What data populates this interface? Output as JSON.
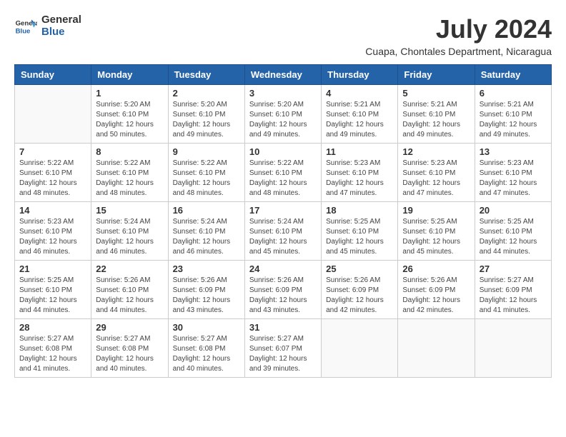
{
  "logo": {
    "line1": "General",
    "line2": "Blue"
  },
  "title": "July 2024",
  "location": "Cuapa, Chontales Department, Nicaragua",
  "days_header": [
    "Sunday",
    "Monday",
    "Tuesday",
    "Wednesday",
    "Thursday",
    "Friday",
    "Saturday"
  ],
  "weeks": [
    [
      {
        "day": "",
        "sunrise": "",
        "sunset": "",
        "daylight": ""
      },
      {
        "day": "1",
        "sunrise": "Sunrise: 5:20 AM",
        "sunset": "Sunset: 6:10 PM",
        "daylight": "Daylight: 12 hours and 50 minutes."
      },
      {
        "day": "2",
        "sunrise": "Sunrise: 5:20 AM",
        "sunset": "Sunset: 6:10 PM",
        "daylight": "Daylight: 12 hours and 49 minutes."
      },
      {
        "day": "3",
        "sunrise": "Sunrise: 5:20 AM",
        "sunset": "Sunset: 6:10 PM",
        "daylight": "Daylight: 12 hours and 49 minutes."
      },
      {
        "day": "4",
        "sunrise": "Sunrise: 5:21 AM",
        "sunset": "Sunset: 6:10 PM",
        "daylight": "Daylight: 12 hours and 49 minutes."
      },
      {
        "day": "5",
        "sunrise": "Sunrise: 5:21 AM",
        "sunset": "Sunset: 6:10 PM",
        "daylight": "Daylight: 12 hours and 49 minutes."
      },
      {
        "day": "6",
        "sunrise": "Sunrise: 5:21 AM",
        "sunset": "Sunset: 6:10 PM",
        "daylight": "Daylight: 12 hours and 49 minutes."
      }
    ],
    [
      {
        "day": "7",
        "sunrise": "Sunrise: 5:22 AM",
        "sunset": "Sunset: 6:10 PM",
        "daylight": "Daylight: 12 hours and 48 minutes."
      },
      {
        "day": "8",
        "sunrise": "Sunrise: 5:22 AM",
        "sunset": "Sunset: 6:10 PM",
        "daylight": "Daylight: 12 hours and 48 minutes."
      },
      {
        "day": "9",
        "sunrise": "Sunrise: 5:22 AM",
        "sunset": "Sunset: 6:10 PM",
        "daylight": "Daylight: 12 hours and 48 minutes."
      },
      {
        "day": "10",
        "sunrise": "Sunrise: 5:22 AM",
        "sunset": "Sunset: 6:10 PM",
        "daylight": "Daylight: 12 hours and 48 minutes."
      },
      {
        "day": "11",
        "sunrise": "Sunrise: 5:23 AM",
        "sunset": "Sunset: 6:10 PM",
        "daylight": "Daylight: 12 hours and 47 minutes."
      },
      {
        "day": "12",
        "sunrise": "Sunrise: 5:23 AM",
        "sunset": "Sunset: 6:10 PM",
        "daylight": "Daylight: 12 hours and 47 minutes."
      },
      {
        "day": "13",
        "sunrise": "Sunrise: 5:23 AM",
        "sunset": "Sunset: 6:10 PM",
        "daylight": "Daylight: 12 hours and 47 minutes."
      }
    ],
    [
      {
        "day": "14",
        "sunrise": "Sunrise: 5:23 AM",
        "sunset": "Sunset: 6:10 PM",
        "daylight": "Daylight: 12 hours and 46 minutes."
      },
      {
        "day": "15",
        "sunrise": "Sunrise: 5:24 AM",
        "sunset": "Sunset: 6:10 PM",
        "daylight": "Daylight: 12 hours and 46 minutes."
      },
      {
        "day": "16",
        "sunrise": "Sunrise: 5:24 AM",
        "sunset": "Sunset: 6:10 PM",
        "daylight": "Daylight: 12 hours and 46 minutes."
      },
      {
        "day": "17",
        "sunrise": "Sunrise: 5:24 AM",
        "sunset": "Sunset: 6:10 PM",
        "daylight": "Daylight: 12 hours and 45 minutes."
      },
      {
        "day": "18",
        "sunrise": "Sunrise: 5:25 AM",
        "sunset": "Sunset: 6:10 PM",
        "daylight": "Daylight: 12 hours and 45 minutes."
      },
      {
        "day": "19",
        "sunrise": "Sunrise: 5:25 AM",
        "sunset": "Sunset: 6:10 PM",
        "daylight": "Daylight: 12 hours and 45 minutes."
      },
      {
        "day": "20",
        "sunrise": "Sunrise: 5:25 AM",
        "sunset": "Sunset: 6:10 PM",
        "daylight": "Daylight: 12 hours and 44 minutes."
      }
    ],
    [
      {
        "day": "21",
        "sunrise": "Sunrise: 5:25 AM",
        "sunset": "Sunset: 6:10 PM",
        "daylight": "Daylight: 12 hours and 44 minutes."
      },
      {
        "day": "22",
        "sunrise": "Sunrise: 5:26 AM",
        "sunset": "Sunset: 6:10 PM",
        "daylight": "Daylight: 12 hours and 44 minutes."
      },
      {
        "day": "23",
        "sunrise": "Sunrise: 5:26 AM",
        "sunset": "Sunset: 6:09 PM",
        "daylight": "Daylight: 12 hours and 43 minutes."
      },
      {
        "day": "24",
        "sunrise": "Sunrise: 5:26 AM",
        "sunset": "Sunset: 6:09 PM",
        "daylight": "Daylight: 12 hours and 43 minutes."
      },
      {
        "day": "25",
        "sunrise": "Sunrise: 5:26 AM",
        "sunset": "Sunset: 6:09 PM",
        "daylight": "Daylight: 12 hours and 42 minutes."
      },
      {
        "day": "26",
        "sunrise": "Sunrise: 5:26 AM",
        "sunset": "Sunset: 6:09 PM",
        "daylight": "Daylight: 12 hours and 42 minutes."
      },
      {
        "day": "27",
        "sunrise": "Sunrise: 5:27 AM",
        "sunset": "Sunset: 6:09 PM",
        "daylight": "Daylight: 12 hours and 41 minutes."
      }
    ],
    [
      {
        "day": "28",
        "sunrise": "Sunrise: 5:27 AM",
        "sunset": "Sunset: 6:08 PM",
        "daylight": "Daylight: 12 hours and 41 minutes."
      },
      {
        "day": "29",
        "sunrise": "Sunrise: 5:27 AM",
        "sunset": "Sunset: 6:08 PM",
        "daylight": "Daylight: 12 hours and 40 minutes."
      },
      {
        "day": "30",
        "sunrise": "Sunrise: 5:27 AM",
        "sunset": "Sunset: 6:08 PM",
        "daylight": "Daylight: 12 hours and 40 minutes."
      },
      {
        "day": "31",
        "sunrise": "Sunrise: 5:27 AM",
        "sunset": "Sunset: 6:07 PM",
        "daylight": "Daylight: 12 hours and 39 minutes."
      },
      {
        "day": "",
        "sunrise": "",
        "sunset": "",
        "daylight": ""
      },
      {
        "day": "",
        "sunrise": "",
        "sunset": "",
        "daylight": ""
      },
      {
        "day": "",
        "sunrise": "",
        "sunset": "",
        "daylight": ""
      }
    ]
  ]
}
